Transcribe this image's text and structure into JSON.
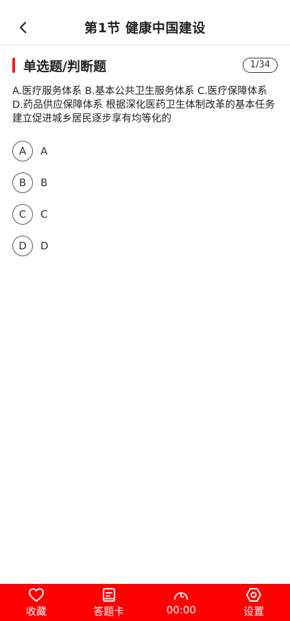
{
  "header": {
    "title": "第1节 健康中国建设",
    "back_icon": "chevron-left-icon"
  },
  "section": {
    "title": "单选题/判断题",
    "progress": "1/34",
    "accent_color": "#ff1a1a"
  },
  "question": {
    "text": "A.医疗服务体系 B.基本公共卫生服务体系 C.医疗保障体系 D.药品供应保障体系 根据深化医药卫生体制改革的基本任务建立促进城乡居民逐步享有均等化的"
  },
  "options": [
    {
      "letter": "A",
      "text": "A"
    },
    {
      "letter": "B",
      "text": "B"
    },
    {
      "letter": "C",
      "text": "C"
    },
    {
      "letter": "D",
      "text": "D"
    }
  ],
  "bottom_bar": {
    "background": "#ff0000",
    "tabs": [
      {
        "label": "收藏",
        "icon": "heart-icon"
      },
      {
        "label": "答题卡",
        "icon": "answer-sheet-icon"
      },
      {
        "label": "00:00",
        "icon": "timer-icon"
      },
      {
        "label": "设置",
        "icon": "settings-icon"
      }
    ]
  }
}
